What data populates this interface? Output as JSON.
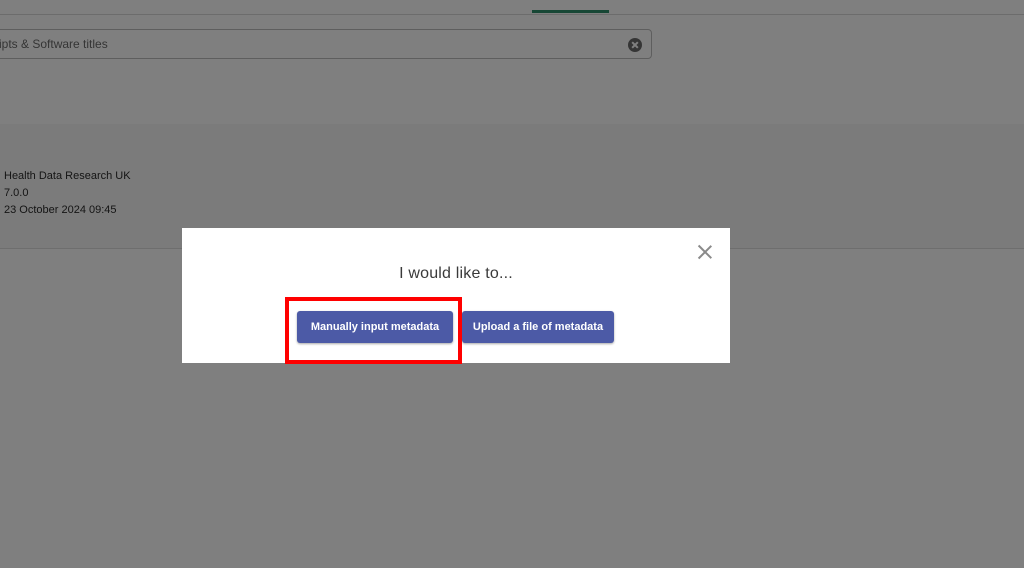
{
  "search": {
    "placeholder": "cripts & Software titles"
  },
  "result": {
    "publisher": "Health Data Research UK",
    "version": "7.0.0",
    "updated": "23 October 2024 09:45"
  },
  "modal": {
    "title": "I would like to...",
    "close_icon": "close-icon",
    "buttons": {
      "manual_label": "Manually input metadata",
      "upload_label": "Upload a file of metadata"
    }
  },
  "colors": {
    "accent": "#4c5aa6",
    "tab_indicator": "#2f8f6b",
    "highlight": "#ff0000"
  }
}
